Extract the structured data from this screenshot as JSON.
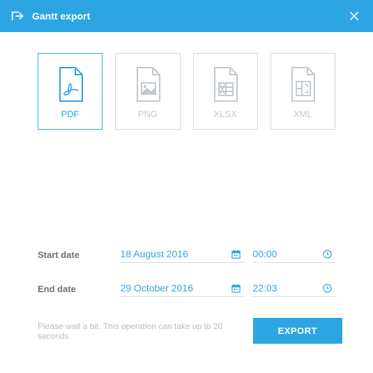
{
  "header": {
    "title": "Gantt export"
  },
  "formats": [
    {
      "label": "PDF",
      "active": true
    },
    {
      "label": "PNG",
      "active": false
    },
    {
      "label": "XLSX",
      "active": false
    },
    {
      "label": "XML",
      "active": false
    }
  ],
  "dates": {
    "start_label": "Start date",
    "start_date": "18 August 2016",
    "start_time": "00:00",
    "end_label": "End date",
    "end_date": "29 October 2016",
    "end_time": "22:03"
  },
  "footer": {
    "message": "Please wait a bit. This operation can take up to 20 seconds.",
    "button": "EXPORT"
  }
}
